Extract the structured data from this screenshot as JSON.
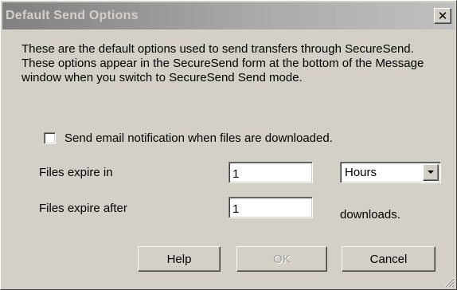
{
  "window": {
    "title": "Default Send Options"
  },
  "description": "These are the default options used to send transfers through SecureSend. These options appear in the SecureSend form at the bottom of the Message window when you switch to SecureSend Send mode.",
  "notify": {
    "label": "Send email notification when files are downloaded.",
    "checked": false
  },
  "expire_in": {
    "label": "Files expire in",
    "value": "1",
    "unit": "Hours"
  },
  "expire_after": {
    "label": "Files expire after",
    "value": "1",
    "suffix": "downloads."
  },
  "buttons": {
    "help": "Help",
    "ok": "OK",
    "cancel": "Cancel"
  },
  "icons": {
    "close": "close-icon",
    "dropdown": "chevron-down-icon",
    "grip": "resize-grip-icon"
  }
}
